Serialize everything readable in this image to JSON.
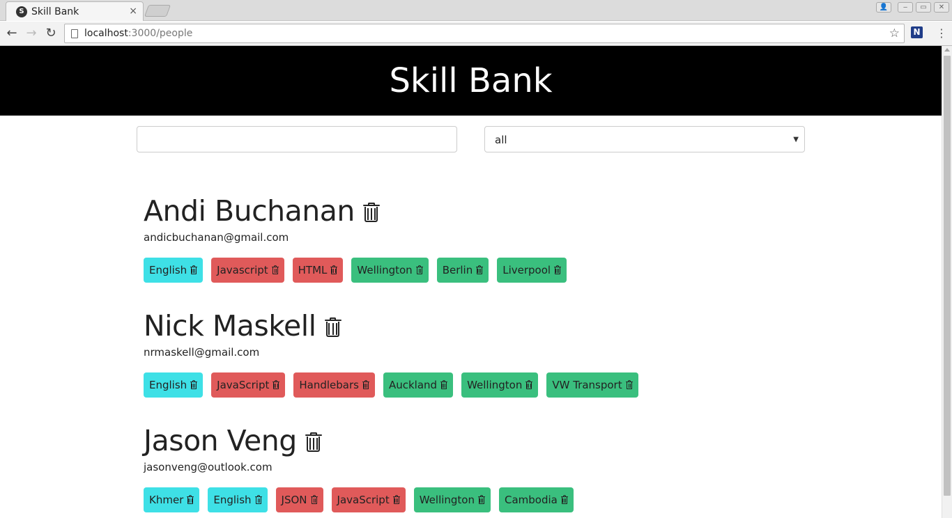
{
  "browser": {
    "tab_title": "Skill Bank",
    "tab_favicon": "S",
    "tab_close": "×",
    "url_host": "localhost",
    "url_path": ":3000/people",
    "back_icon": "←",
    "forward_icon": "→",
    "reload_icon": "↻",
    "star_icon": "☆",
    "extension_label": "N",
    "menu_icon": "⋮",
    "window_minimize": "‒",
    "window_maximize": "▭",
    "window_close": "✕",
    "window_user": "👤"
  },
  "header": {
    "title": "Skill Bank"
  },
  "search": {
    "value": "",
    "placeholder": ""
  },
  "filter": {
    "selected": "all"
  },
  "people": [
    {
      "name": "Andi Buchanan",
      "email": "andicbuchanan@gmail.com",
      "tags": [
        {
          "label": "English",
          "kind": "language"
        },
        {
          "label": "Javascript",
          "kind": "skill"
        },
        {
          "label": "HTML",
          "kind": "skill"
        },
        {
          "label": "Wellington",
          "kind": "place"
        },
        {
          "label": "Berlin",
          "kind": "place"
        },
        {
          "label": "Liverpool",
          "kind": "place"
        }
      ]
    },
    {
      "name": "Nick Maskell",
      "email": "nrmaskell@gmail.com",
      "tags": [
        {
          "label": "English",
          "kind": "language"
        },
        {
          "label": "JavaScript",
          "kind": "skill"
        },
        {
          "label": "Handlebars",
          "kind": "skill"
        },
        {
          "label": "Auckland",
          "kind": "place"
        },
        {
          "label": "Wellington",
          "kind": "place"
        },
        {
          "label": "VW Transport",
          "kind": "place"
        }
      ]
    },
    {
      "name": "Jason Veng",
      "email": "jasonveng@outlook.com",
      "tags": [
        {
          "label": "Khmer",
          "kind": "language"
        },
        {
          "label": "English",
          "kind": "language"
        },
        {
          "label": "JSON",
          "kind": "skill"
        },
        {
          "label": "JavaScript",
          "kind": "skill"
        },
        {
          "label": "Wellington",
          "kind": "place"
        },
        {
          "label": "Cambodia",
          "kind": "place"
        }
      ]
    }
  ],
  "colors": {
    "header_bg": "#000000",
    "language_tag": "#3ee0e6",
    "skill_tag": "#e05a5a",
    "place_tag": "#3abf7e"
  }
}
